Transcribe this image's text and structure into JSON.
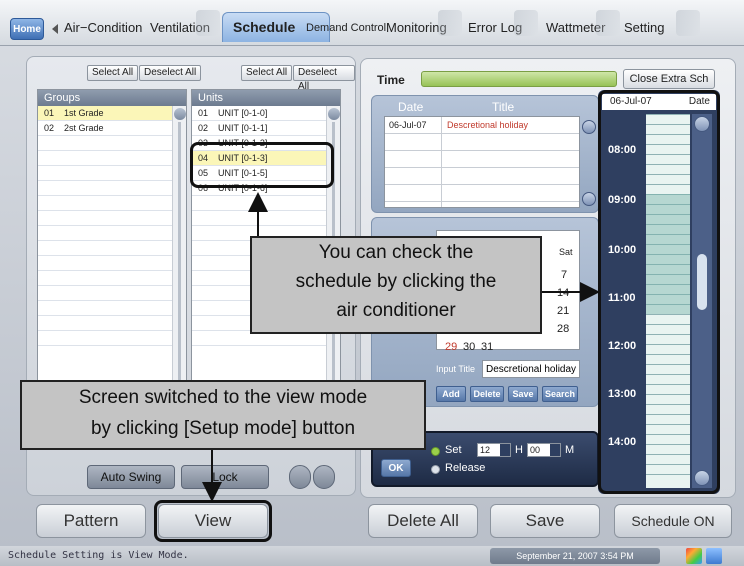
{
  "tabs": {
    "home": "Home",
    "items": [
      {
        "label": "Air−Condition"
      },
      {
        "label": "Ventilation"
      },
      {
        "label": "Schedule"
      },
      {
        "label": "Demand Control"
      },
      {
        "label": "Monitoring"
      },
      {
        "label": "Error Log"
      },
      {
        "label": "Wattmeter"
      },
      {
        "label": "Setting"
      }
    ]
  },
  "groups": {
    "select_all": "Select All",
    "deselect_all": "Deselect All",
    "header": "Groups",
    "rows": [
      {
        "num": "01",
        "name": "1st Grade"
      },
      {
        "num": "02",
        "name": "2st Grade"
      }
    ]
  },
  "units": {
    "select_all": "Select All",
    "deselect_all": "Deselect All",
    "header": "Units",
    "rows": [
      {
        "num": "01",
        "name": "UNIT [0-1-0]"
      },
      {
        "num": "02",
        "name": "UNIT [0-1-1]"
      },
      {
        "num": "03",
        "name": "UNIT [0-1-2]"
      },
      {
        "num": "04",
        "name": "UNIT [0-1-3]"
      },
      {
        "num": "05",
        "name": "UNIT [0-1-5]"
      },
      {
        "num": "06",
        "name": "UNIT [0-1-6]"
      }
    ]
  },
  "left_controls": {
    "auto_swing": "Auto Swing",
    "lock": "Lock"
  },
  "bottom": {
    "pattern": "Pattern",
    "view": "View",
    "delete_all": "Delete All",
    "save": "Save",
    "schedule_on": "Schedule ON"
  },
  "time": {
    "label": "Time",
    "close_extra": "Close Extra Sch"
  },
  "schedule_list": {
    "date_header": "Date",
    "title_header": "Title",
    "rows": [
      {
        "date": "06-Jul-07",
        "title": "Descretional holiday"
      }
    ]
  },
  "calendar": {
    "sat_header": "Sat",
    "cells": [
      "7",
      "14",
      "21",
      "28",
      "29",
      "30",
      "31"
    ],
    "input_title_label": "Input Title",
    "input_title_value": "Descretional holiday",
    "add": "Add",
    "delete": "Delete",
    "save": "Save",
    "search": "Search"
  },
  "set_panel": {
    "ok": "OK",
    "set": "Set",
    "release": "Release",
    "hour_value": "12",
    "hour_unit": "H",
    "minute_value": "00",
    "minute_unit": "M"
  },
  "timeline": {
    "date": "06-Jul-07",
    "date_word": "Date",
    "hours": [
      "08:00",
      "09:00",
      "10:00",
      "11:00",
      "12:00",
      "13:00",
      "14:00"
    ]
  },
  "status": {
    "text": "Schedule Setting is View Mode.",
    "clock": "September 21, 2007 3:54 PM"
  },
  "annotations": {
    "callout_right": [
      "You can check the",
      "schedule by clicking the",
      "air conditioner"
    ],
    "callout_left": [
      "Screen switched to the view mode",
      "by clicking [Setup mode] button"
    ]
  },
  "colors": {
    "accent": "#6d93c4",
    "selected_row": "#fbf6b8",
    "holiday_red": "#c0392b",
    "timeline_bg": "#2f3f60"
  }
}
